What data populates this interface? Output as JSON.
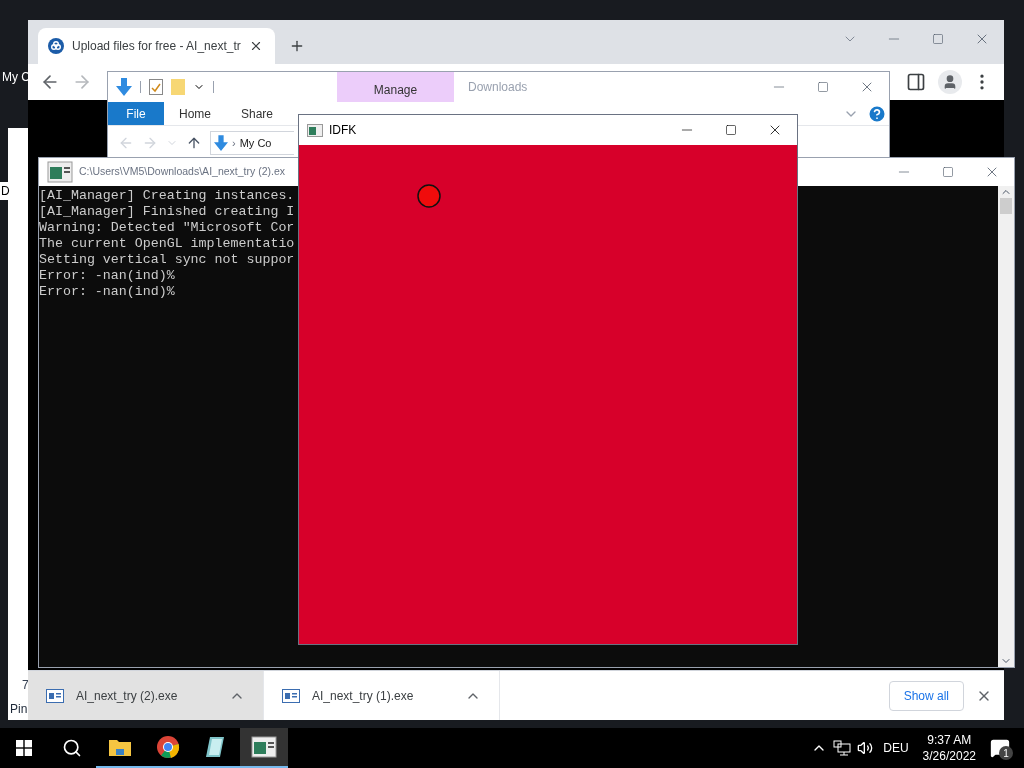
{
  "desktop": {
    "labels": [
      "My C",
      "D"
    ],
    "side_window": {
      "texts": [
        "7",
        "Pin"
      ]
    }
  },
  "browser": {
    "tab_title": "Upload files for free - AI_next_tr",
    "downloads": [
      {
        "name": "AI_next_try (2).exe",
        "selected": true
      },
      {
        "name": "AI_next_try (1).exe",
        "selected": false
      }
    ],
    "show_all": "Show all"
  },
  "explorer": {
    "title": "Downloads",
    "context_tab": "Manage",
    "ribbon_tabs": [
      {
        "label": "File",
        "selected": true
      },
      {
        "label": "Home",
        "selected": false
      },
      {
        "label": "Share",
        "selected": false
      }
    ],
    "separator": "›",
    "breadcrumb": "My Co"
  },
  "console": {
    "title": "C:\\Users\\VM5\\Downloads\\AI_next_try (2).ex",
    "lines": [
      "[AI_Manager] Creating instances.",
      "[AI_Manager] Finished creating I",
      "Warning: Detected \"Microsoft Cor",
      "The current OpenGL implementatio",
      "Setting vertical sync not suppor",
      "Error: -nan(ind)%",
      "Error: -nan(ind)%"
    ]
  },
  "game_window": {
    "title": "IDFK"
  },
  "taskbar": {
    "apps": [
      {
        "kind": "folder",
        "active": false
      },
      {
        "kind": "chrome",
        "active": false
      },
      {
        "kind": "notepad",
        "active": false
      },
      {
        "kind": "console",
        "active": true
      }
    ],
    "language": "DEU",
    "time": "9:37 AM",
    "date": "3/26/2022",
    "notifications": "1"
  }
}
